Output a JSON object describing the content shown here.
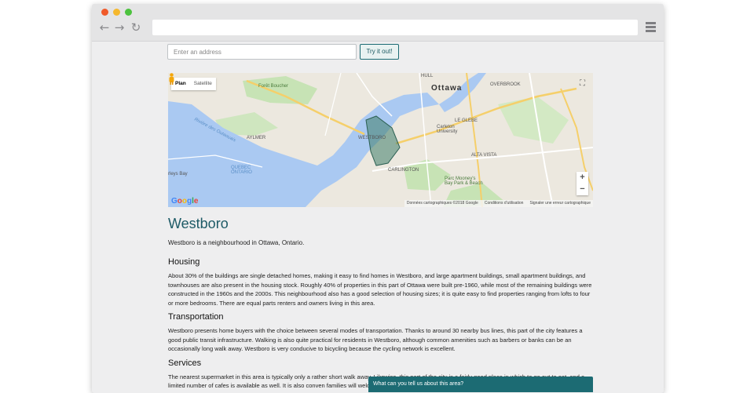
{
  "colors": {
    "accent": "#1c6b73",
    "title": "#1d5a66",
    "water": "#aac9f2",
    "park": "#c7e3b5",
    "road_major": "#f5cf6a",
    "neighbourhood": "#3f7d6a"
  },
  "browser": {
    "back_icon": "arrow-left-icon",
    "forward_icon": "arrow-right-icon",
    "reload_icon": "reload-icon",
    "menu_icon": "hamburger-menu-icon"
  },
  "search": {
    "placeholder": "Enter an address",
    "button_label": "Try it out!"
  },
  "map": {
    "type_controls": [
      "Plan",
      "Satellite"
    ],
    "labels": {
      "city": "Ottawa",
      "foret": "Forêt Boucher",
      "aylmer": "AYLMER",
      "westboro": "WESTBORO",
      "carleton": "Carleton University",
      "carlington": "CARLINGTON",
      "glebe": "LE GLEBE",
      "alta_vista": "ALTA VISTA",
      "parc": "Parc Mooney's Bay Park & Beach",
      "overbrook": "OVERBROOK",
      "quebec": "QUEBEC ONTARIO",
      "bay": "rleys Bay",
      "river": "Rivière des Outaouais",
      "hull": "HULL"
    },
    "attribution": [
      "Données cartographiques ©2018 Google",
      "Conditions d'utilisation",
      "Signaler une erreur cartographique"
    ],
    "logo_text": "Google"
  },
  "article": {
    "title": "Westboro",
    "intro": "Westboro is a neighbourhood in Ottawa, Ontario.",
    "sections": [
      {
        "heading": "Housing",
        "body": "About 30% of the buildings are single detached homes, making it easy to find homes in Westboro, and large apartment buildings, small apartment buildings, and townhouses are also present in the housing stock. Roughly 40% of properties in this part of Ottawa were built pre-1960, while most of the remaining buildings were constructed in the 1960s and the 2000s. This neighbourhood also has a good selection of housing sizes; it is quite easy to find properties ranging from lofts to four or more bedrooms. There are equal parts renters and owners living in this area."
      },
      {
        "heading": "Transportation",
        "body": "Westboro presents home buyers with the choice between several modes of transportation. Thanks to around 30 nearby bus lines, this part of the city features a good public transit infrastructure. Walking is also quite practical for residents in Westboro, although common amenities such as barbers or banks can be an occasionally long walk away. Westboro is very conducive to bicycling because the cycling network is excellent."
      },
      {
        "heading": "Services",
        "body": "The nearest supermarket in this area is typically only a rather short walk away. Likewise, this part of the city is a fairly good place in which to go out to eat, and a limited number of cafes is available as well. It is also conven families will welcome the proximity to schools and daycares, which are"
      }
    ]
  },
  "chat": {
    "prompt": "What can you tell us about this area?"
  }
}
